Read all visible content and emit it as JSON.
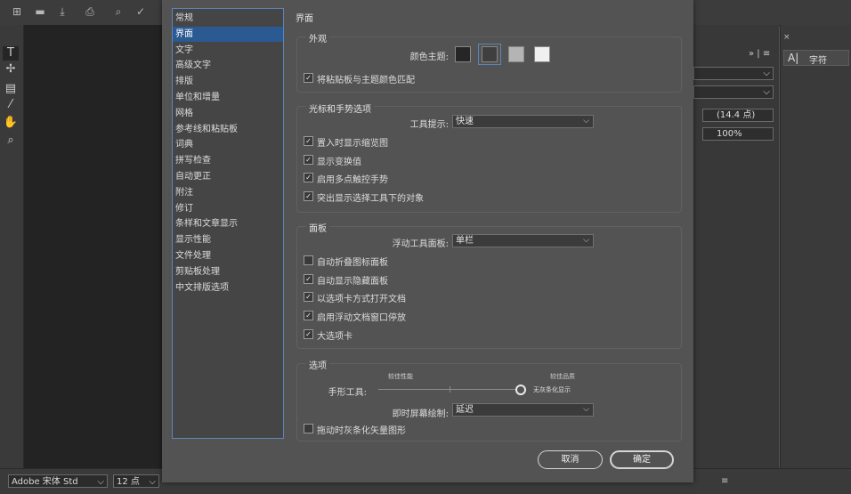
{
  "dialog": {
    "categories": [
      "常规",
      "界面",
      "文字",
      "高级文字",
      "排版",
      "单位和增量",
      "网格",
      "参考线和粘贴板",
      "词典",
      "拼写检查",
      "自动更正",
      "附注",
      "修订",
      "条样和文章显示",
      "显示性能",
      "文件处理",
      "剪贴板处理",
      "中文排版选项"
    ],
    "selected_index": 1,
    "page_title": "界面",
    "appearance": {
      "title": "外观",
      "theme_label": "颜色主题:",
      "theme_colors": [
        "#262626",
        "#3f3f3f",
        "#b4b4b4",
        "#f0f0f0"
      ],
      "selected_theme_index": 1,
      "match_pasteboard": "将粘贴板与主题颜色匹配"
    },
    "cursor": {
      "title": "光标和手势选项",
      "tooltip_label": "工具提示:",
      "tooltip_value": "快速",
      "options": [
        "置入时显示缩览图",
        "显示变换值",
        "启用多点触控手势",
        "突出显示选择工具下的对象"
      ],
      "options_checked": [
        true,
        true,
        true,
        true
      ]
    },
    "panels": {
      "title": "面板",
      "floating_label": "浮动工具面板:",
      "floating_value": "单栏",
      "options": [
        "自动折叠图标面板",
        "自动显示隐藏面板",
        "以选项卡方式打开文档",
        "启用浮动文档窗口停放",
        "大选项卡"
      ],
      "options_checked": [
        false,
        true,
        true,
        true,
        true
      ]
    },
    "options": {
      "title": "选项",
      "hand_tool_label": "手形工具:",
      "left_caption": "较佳性能",
      "right_caption": "较佳品质",
      "slider_value_label": "无灰条化显示",
      "slider_position": 1.0,
      "live_draw_label": "即时屏幕绘制:",
      "live_draw_value": "延迟",
      "greek_vector": "拖动时灰条化矢量图形",
      "greek_vector_checked": false
    },
    "cancel_label": "取消",
    "ok_label": "确定"
  },
  "app": {
    "font_name": "Adobe 宋体 Std",
    "font_size": "12 点",
    "leading": "(14.4 点)",
    "scale": "100%",
    "panel_tab": "字符"
  }
}
